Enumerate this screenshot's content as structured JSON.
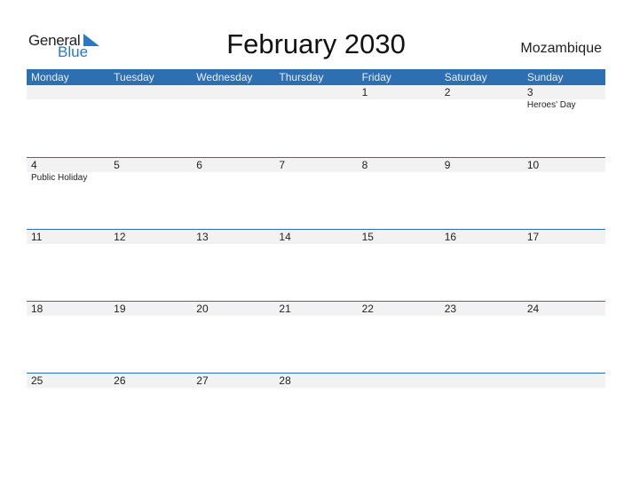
{
  "logo": {
    "line1": "General",
    "line2": "Blue"
  },
  "title": "February 2030",
  "country": "Mozambique",
  "colors": {
    "accent": "#2e6fb2",
    "row_bg": "#f2f2f2"
  },
  "weekdays": [
    "Monday",
    "Tuesday",
    "Wednesday",
    "Thursday",
    "Friday",
    "Saturday",
    "Sunday"
  ],
  "weeks": [
    {
      "days": [
        "",
        "",
        "",
        "",
        "1",
        "2",
        "3"
      ],
      "events": [
        "",
        "",
        "",
        "",
        "",
        "",
        "Heroes' Day"
      ]
    },
    {
      "days": [
        "4",
        "5",
        "6",
        "7",
        "8",
        "9",
        "10"
      ],
      "events": [
        "Public Holiday",
        "",
        "",
        "",
        "",
        "",
        ""
      ]
    },
    {
      "days": [
        "11",
        "12",
        "13",
        "14",
        "15",
        "16",
        "17"
      ],
      "events": [
        "",
        "",
        "",
        "",
        "",
        "",
        ""
      ]
    },
    {
      "days": [
        "18",
        "19",
        "20",
        "21",
        "22",
        "23",
        "24"
      ],
      "events": [
        "",
        "",
        "",
        "",
        "",
        "",
        ""
      ]
    },
    {
      "days": [
        "25",
        "26",
        "27",
        "28",
        "",
        "",
        ""
      ],
      "events": [
        "",
        "",
        "",
        "",
        "",
        "",
        ""
      ]
    }
  ]
}
